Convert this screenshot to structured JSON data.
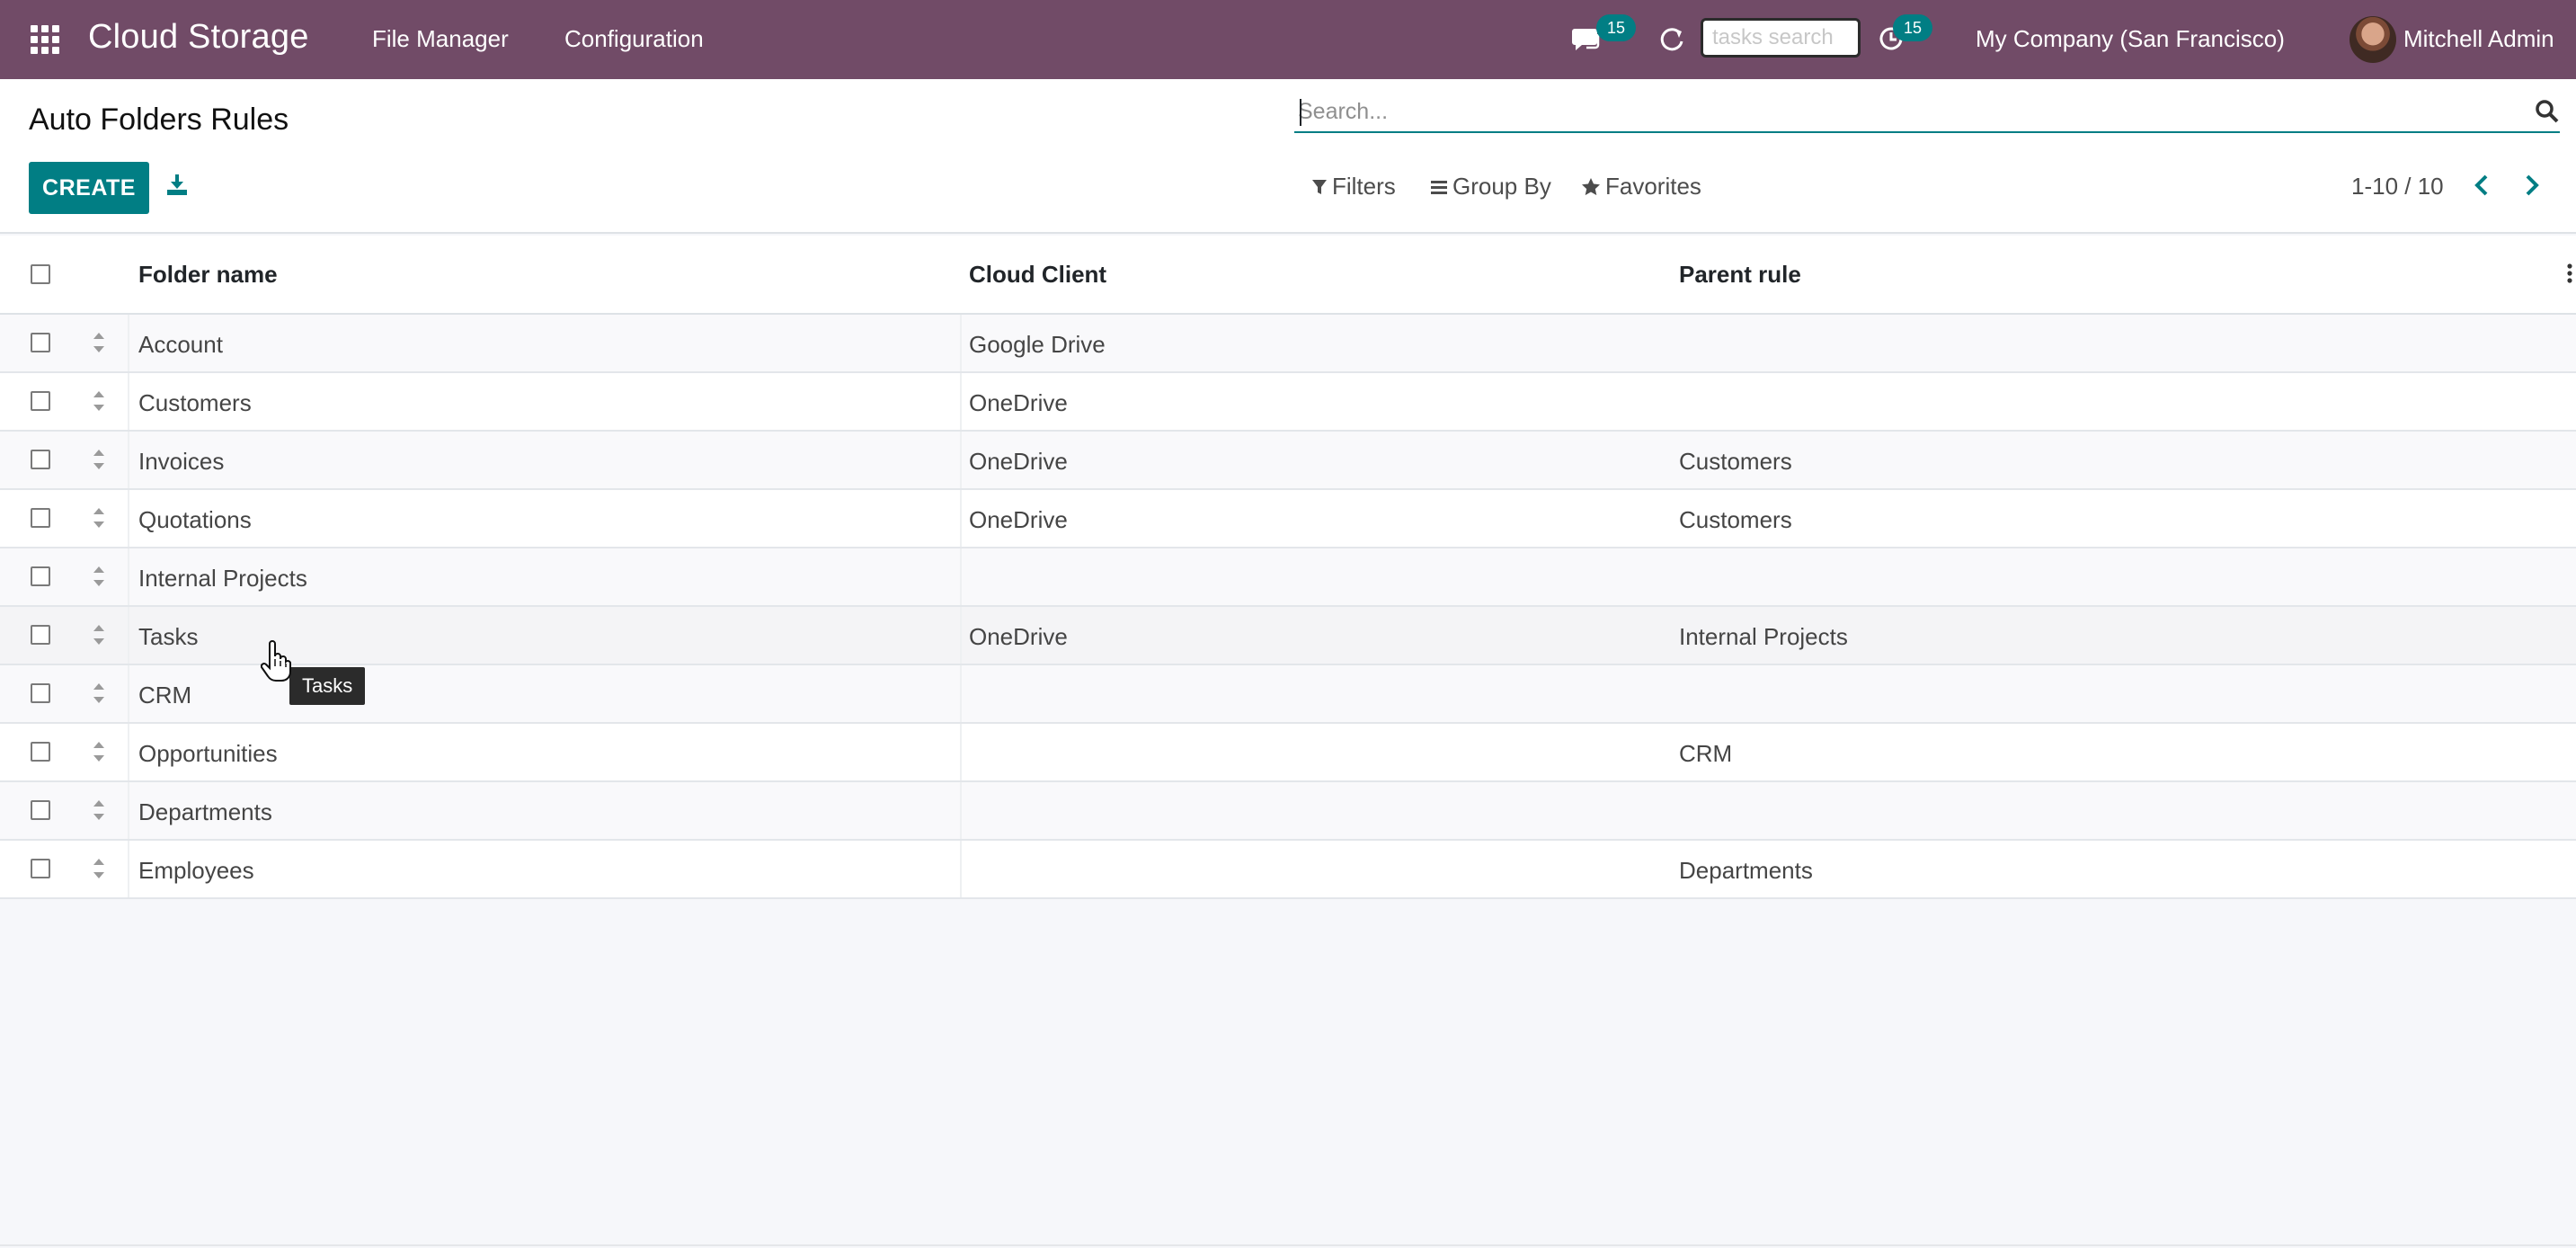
{
  "navbar": {
    "app_name": "Cloud Storage",
    "menus": [
      "File Manager",
      "Configuration"
    ],
    "messages_count": "15",
    "activities_count": "15",
    "search_placeholder": "tasks search",
    "company": "My Company (San Francisco)",
    "user": "Mitchell Admin"
  },
  "control_panel": {
    "title": "Auto Folders Rules",
    "create_label": "CREATE",
    "search_placeholder": "Search...",
    "filters_label": "Filters",
    "group_by_label": "Group By",
    "favorites_label": "Favorites",
    "pager": "1-10 / 10"
  },
  "table": {
    "columns": [
      "Folder name",
      "Cloud Client",
      "Parent rule"
    ],
    "rows": [
      {
        "folder": "Account",
        "client": "Google Drive",
        "parent": ""
      },
      {
        "folder": "Customers",
        "client": "OneDrive",
        "parent": ""
      },
      {
        "folder": "Invoices",
        "client": "OneDrive",
        "parent": "Customers"
      },
      {
        "folder": "Quotations",
        "client": "OneDrive",
        "parent": "Customers"
      },
      {
        "folder": "Internal Projects",
        "client": "",
        "parent": ""
      },
      {
        "folder": "Tasks",
        "client": "OneDrive",
        "parent": "Internal Projects"
      },
      {
        "folder": "CRM",
        "client": "",
        "parent": ""
      },
      {
        "folder": "Opportunities",
        "client": "",
        "parent": "CRM"
      },
      {
        "folder": "Departments",
        "client": "",
        "parent": ""
      },
      {
        "folder": "Employees",
        "client": "",
        "parent": "Departments"
      }
    ]
  },
  "tooltip": "Tasks",
  "colors": {
    "navbar": "#714b67",
    "primary": "#017e84"
  }
}
